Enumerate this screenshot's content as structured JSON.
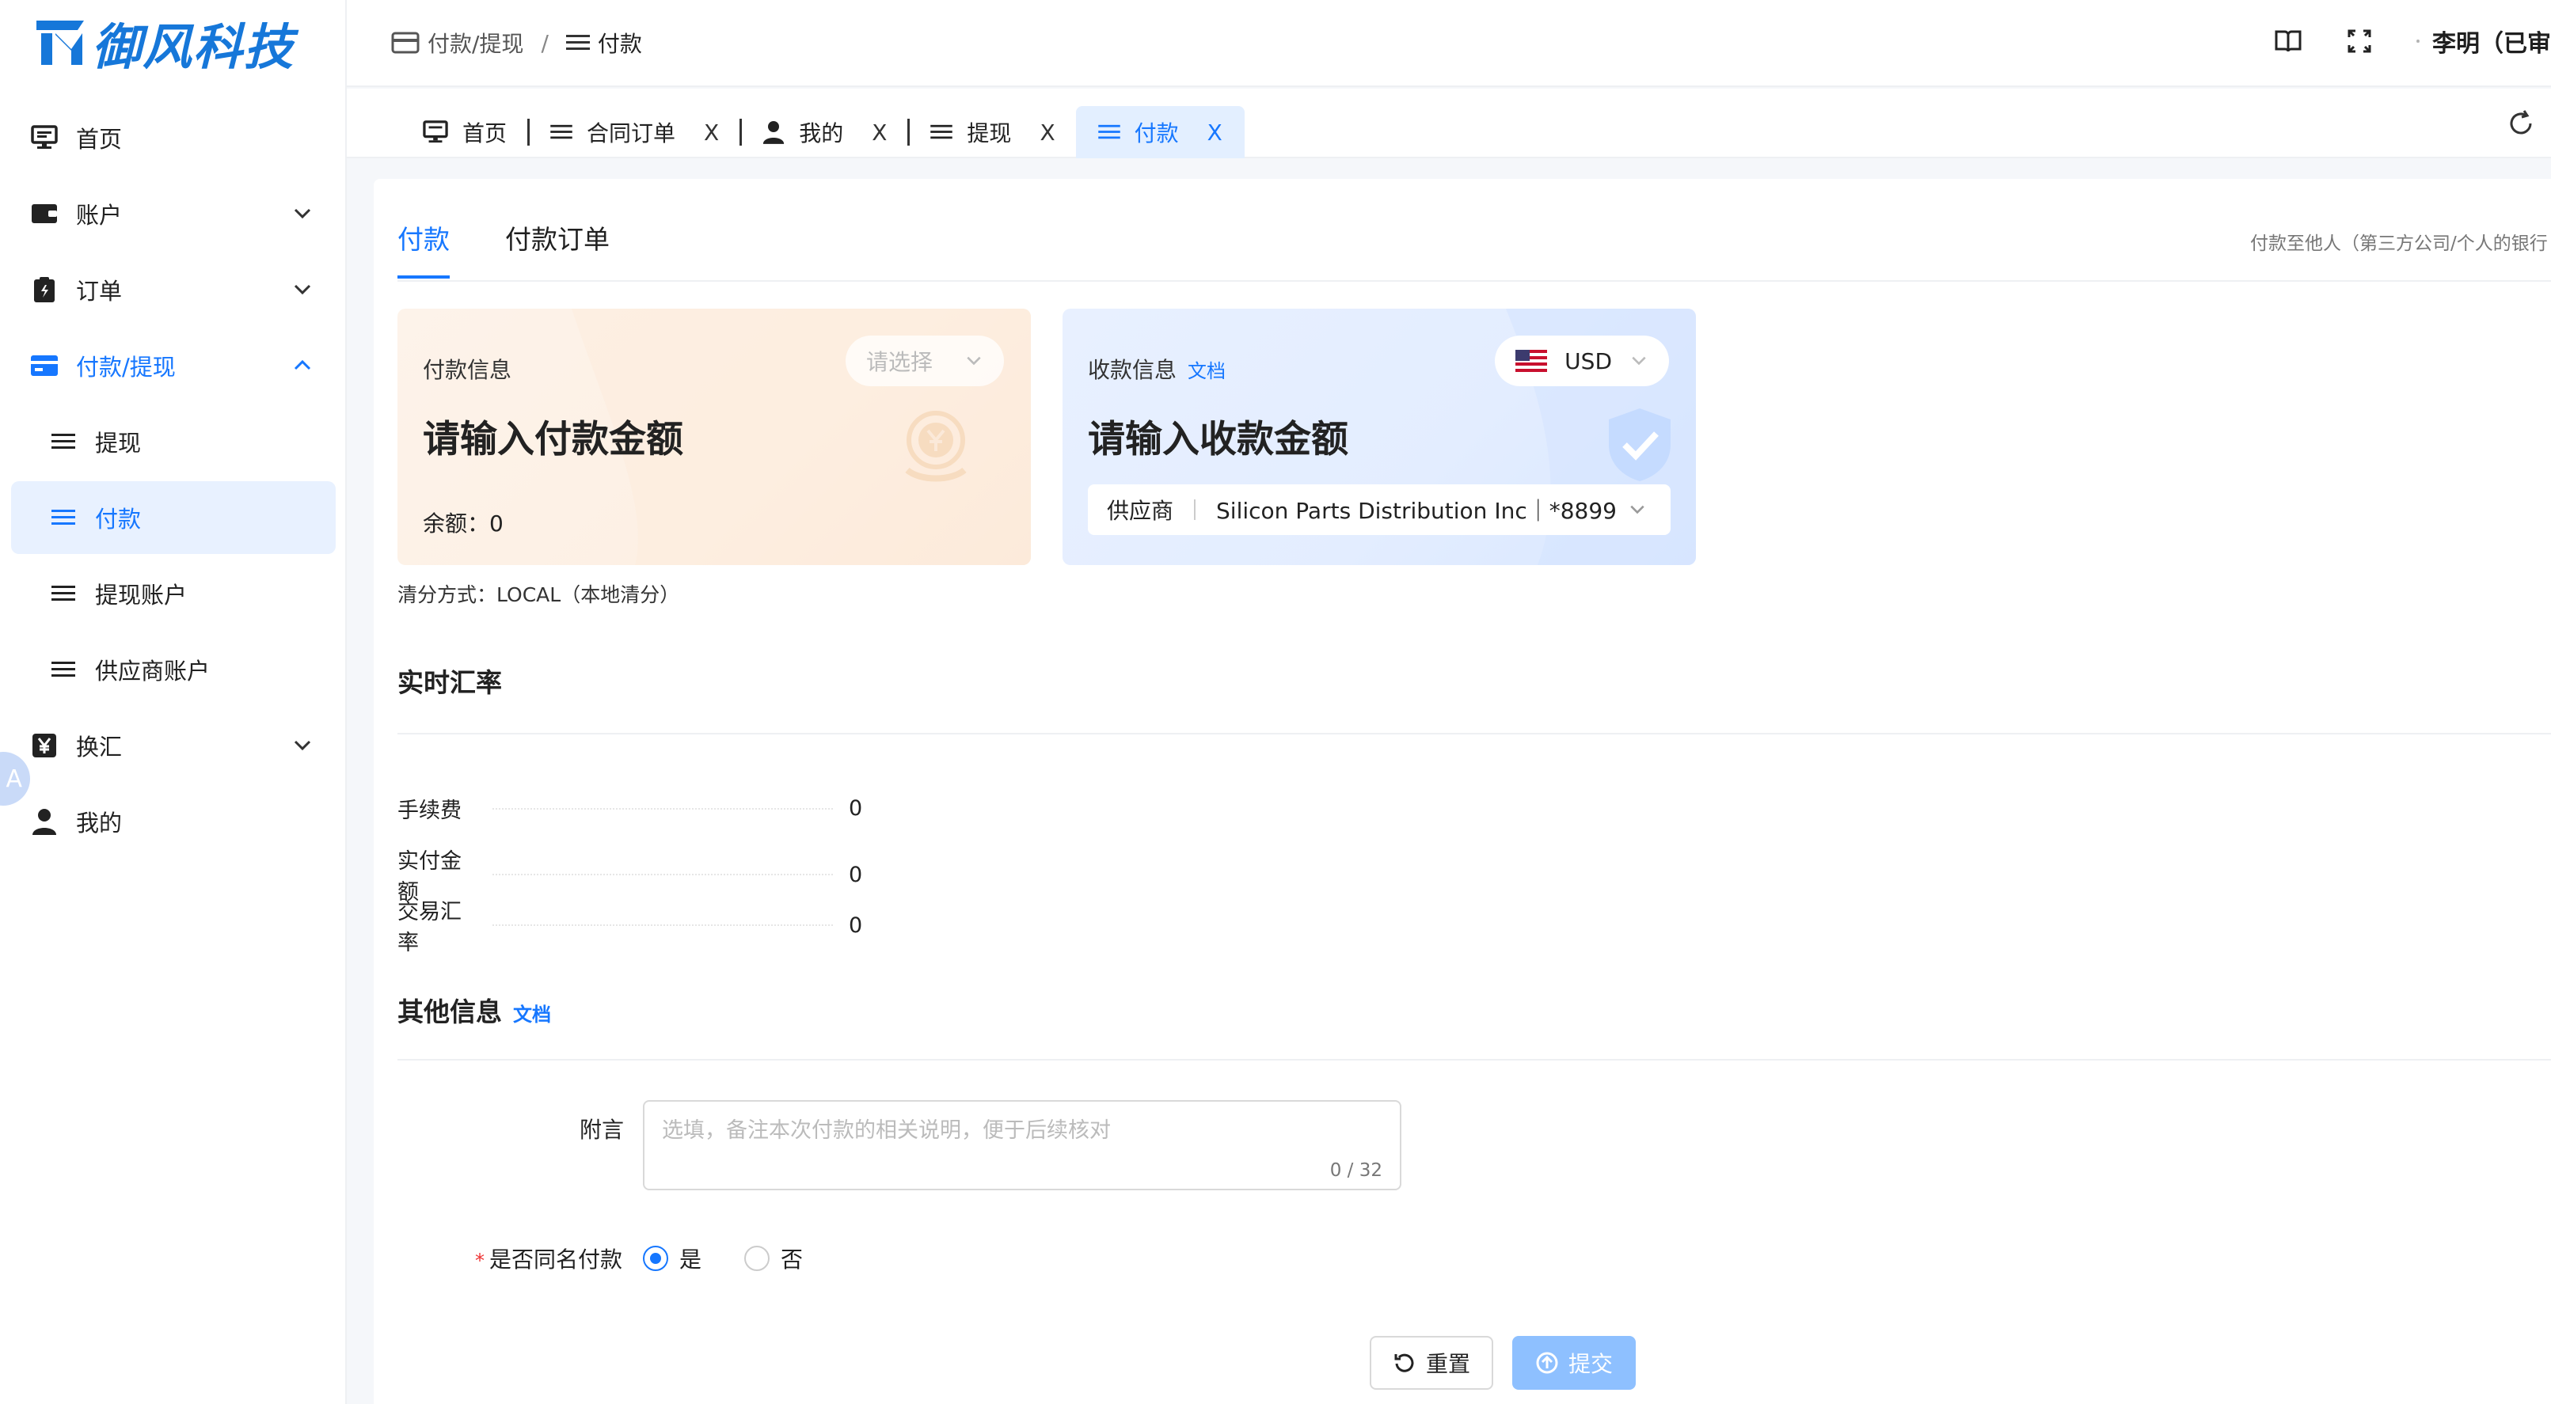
{
  "app": {
    "logo_text": "御风科技"
  },
  "sidebar": {
    "items": [
      {
        "label": "首页",
        "icon": "monitor-icon"
      },
      {
        "label": "账户",
        "icon": "wallet-icon"
      },
      {
        "label": "订单",
        "icon": "clipboard-icon"
      },
      {
        "label": "付款/提现",
        "icon": "card-icon"
      },
      {
        "label": "提现",
        "icon": "menu-icon"
      },
      {
        "label": "付款",
        "icon": "menu-icon"
      },
      {
        "label": "提现账户",
        "icon": "menu-icon"
      },
      {
        "label": "供应商账户",
        "icon": "menu-icon"
      },
      {
        "label": "换汇",
        "icon": "yen-icon"
      },
      {
        "label": "我的",
        "icon": "user-icon"
      }
    ],
    "translate_bubble": "A"
  },
  "topbar": {
    "breadcrumb": [
      "付款/提现",
      "付款"
    ],
    "separator": "/",
    "user_name": "李明（已审"
  },
  "tabs": [
    {
      "label": "首页"
    },
    {
      "label": "合同订单"
    },
    {
      "label": "我的"
    },
    {
      "label": "提现"
    },
    {
      "label": "付款"
    }
  ],
  "tab_close": "X",
  "content": {
    "tabs": [
      "付款",
      "付款订单"
    ],
    "hint": "付款至他人（第三方公司/个人的银行",
    "pay_card": {
      "label": "付款信息",
      "select_placeholder": "请选择",
      "amount_prompt": "请输入付款金额",
      "balance": "余额：0"
    },
    "recv_card": {
      "label": "收款信息",
      "doc_link": "文档",
      "currency": "USD",
      "amount_prompt": "请输入收款金额",
      "supplier_label": "供应商",
      "supplier_value": "Silicon Parts Distribution Inc｜*8899"
    },
    "clear_method": "清分方式：LOCAL（本地清分）",
    "rate_section": {
      "title": "实时汇率",
      "rows": [
        {
          "k": "手续费",
          "v": "0"
        },
        {
          "k": "实付金额",
          "v": "0"
        },
        {
          "k": "交易汇率",
          "v": "0"
        }
      ]
    },
    "other_section": {
      "title": "其他信息",
      "doc_link": "文档",
      "remark_label": "附言",
      "remark_placeholder": "选填，备注本次付款的相关说明，便于后续核对",
      "remark_counter": "0 / 32",
      "same_name_label": "是否同名付款",
      "required_mark": "*",
      "options": [
        "是",
        "否"
      ]
    },
    "buttons": {
      "reset": "重置",
      "submit": "提交"
    }
  },
  "colors": {
    "accent": "#1677ff",
    "logo": "#1677d9"
  }
}
